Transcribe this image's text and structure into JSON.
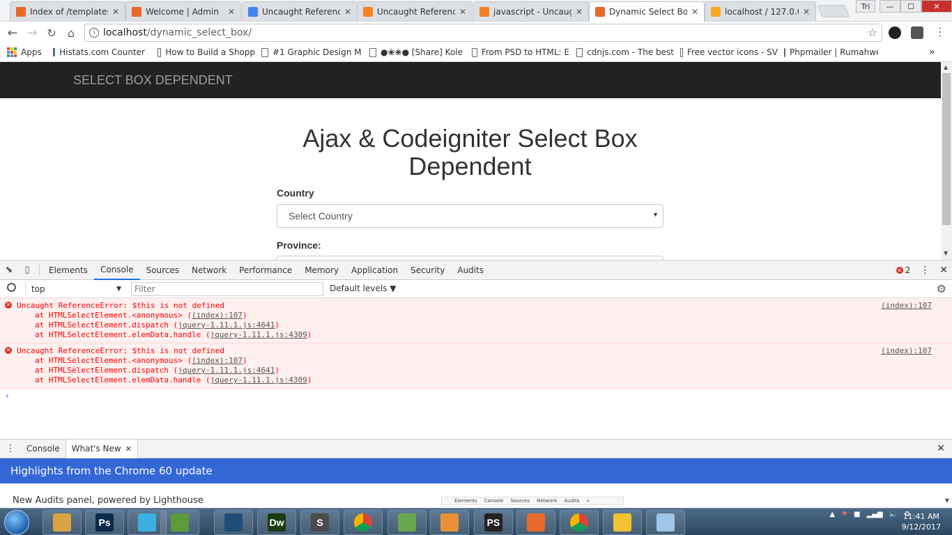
{
  "window": {
    "min": "—",
    "max": "☐",
    "close": "✕",
    "user": "Tri"
  },
  "tabs": [
    {
      "title": "Index of /templates",
      "favicon": "#e8692c"
    },
    {
      "title": "Welcome | Admin",
      "favicon": "#e8692c"
    },
    {
      "title": "Uncaught Reference",
      "favicon": "#4285f4"
    },
    {
      "title": "Uncaught Reference",
      "favicon": "#f48024"
    },
    {
      "title": "javascript - Uncaug",
      "favicon": "#f48024"
    },
    {
      "title": "Dynamic Select Box",
      "favicon": "#e8692c"
    },
    {
      "title": "localhost / 127.0.0.1",
      "favicon": "#f5a623"
    }
  ],
  "address": {
    "host": "localhost",
    "path": "/dynamic_select_box/"
  },
  "bookmarks": [
    "Apps",
    "Histats.com Counter",
    "How to Build a Shopp",
    "#1 Graphic Design M",
    "●❀❀● [Share] Kole",
    "From PSD to HTML: E",
    "cdnjs.com - The best",
    "Free vector icons - SV",
    "Phpmailer | Rumahwe"
  ],
  "bookmarks_more": "»",
  "page": {
    "brand": "SELECT BOX DEPENDENT",
    "heading": "Ajax & Codeigniter Select Box Dependent",
    "country_label": "Country",
    "country_value": "Select Country",
    "province_label": "Province:"
  },
  "devtools": {
    "tabs": [
      "Elements",
      "Console",
      "Sources",
      "Network",
      "Performance",
      "Memory",
      "Application",
      "Security",
      "Audits"
    ],
    "active_tab": "Console",
    "error_count": "2",
    "context": "top",
    "filter_placeholder": "Filter",
    "levels": "Default levels",
    "messages": [
      {
        "text": "Uncaught ReferenceError: $this is not defined",
        "source": "(index):107",
        "stack": [
          {
            "fn": "at HTMLSelectElement.<anonymous> (",
            "link": "(index):107",
            "end": ")"
          },
          {
            "fn": "at HTMLSelectElement.dispatch (",
            "link": "jquery-1.11.1.js:4641",
            "end": ")"
          },
          {
            "fn": "at HTMLSelectElement.elemData.handle (",
            "link": "jquery-1.11.1.js:4309",
            "end": ")"
          }
        ]
      },
      {
        "text": "Uncaught ReferenceError: $this is not defined",
        "source": "(index):107",
        "stack": [
          {
            "fn": "at HTMLSelectElement.<anonymous> (",
            "link": "(index):107",
            "end": ")"
          },
          {
            "fn": "at HTMLSelectElement.dispatch (",
            "link": "jquery-1.11.1.js:4641",
            "end": ")"
          },
          {
            "fn": "at HTMLSelectElement.elemData.handle (",
            "link": "jquery-1.11.1.js:4309",
            "end": ")"
          }
        ]
      }
    ],
    "drawer_tabs": [
      "Console",
      "What's New"
    ],
    "highlights": "Highlights from the Chrome 60 update",
    "audits_text": "New Audits panel, powered by Lighthouse",
    "mini_tabs": [
      "Elements",
      "Console",
      "Sources",
      "Network",
      "Audits",
      "»"
    ]
  },
  "taskbar": {
    "apps": [
      {
        "label": "",
        "color": "#d9a441",
        "name": "file-explorer"
      },
      {
        "label": "Ps",
        "color": "#0b2a4a",
        "name": "photoshop"
      },
      {
        "label": "",
        "color": "#3ab0e0",
        "name": "app-cube"
      },
      {
        "label": "",
        "color": "#5b9b3a",
        "name": "app-leaf"
      },
      {
        "label": "",
        "color": "#1e4e79",
        "name": "mysql-workbench"
      },
      {
        "label": "Dw",
        "color": "#1a3b12",
        "name": "dreamweaver"
      },
      {
        "label": "S",
        "color": "#4b4b4b",
        "name": "sublime-text"
      },
      {
        "label": "",
        "color": "#db4437",
        "name": "chrome-1"
      },
      {
        "label": "",
        "color": "#6aa84f",
        "name": "notepad"
      },
      {
        "label": "",
        "color": "#e69138",
        "name": "settings-app"
      },
      {
        "label": "PS",
        "color": "#222",
        "name": "phpstorm"
      },
      {
        "label": "",
        "color": "#e8692c",
        "name": "app-orange"
      },
      {
        "label": "",
        "color": "#db4437",
        "name": "chrome-2"
      },
      {
        "label": "",
        "color": "#f1c232",
        "name": "media-player"
      },
      {
        "label": "",
        "color": "#9fc5e8",
        "name": "paint"
      }
    ],
    "time": "11:41 AM",
    "date": "9/12/2017"
  }
}
